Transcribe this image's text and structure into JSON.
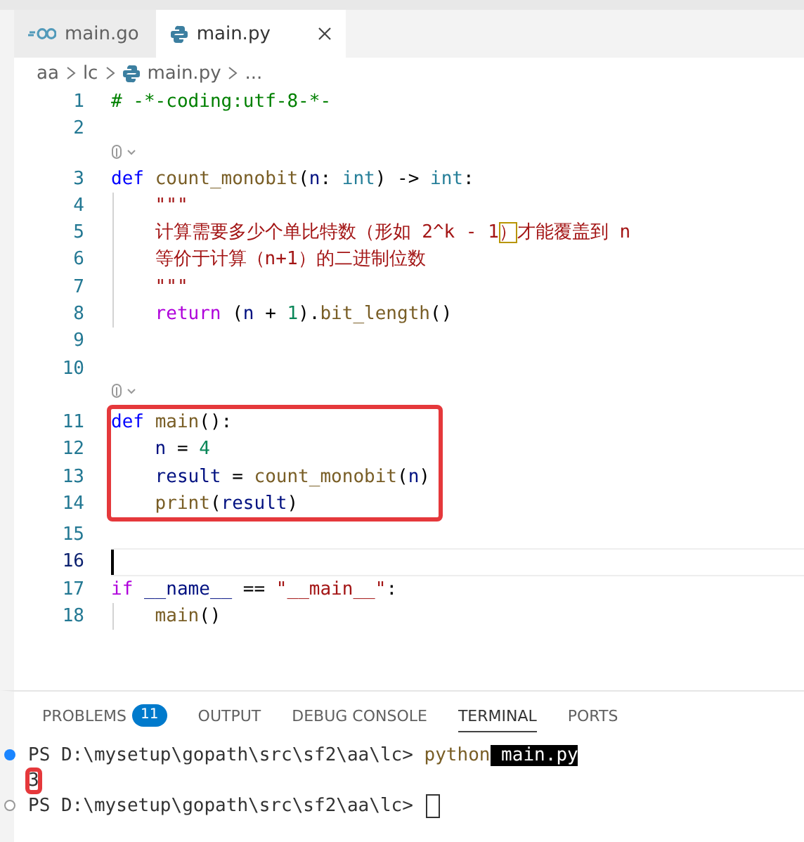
{
  "tabs": [
    {
      "label": "main.go",
      "kind": "go",
      "selected": false
    },
    {
      "label": "main.py",
      "kind": "python",
      "selected": true
    }
  ],
  "breadcrumb": [
    {
      "text": "aa",
      "kind": "folder"
    },
    {
      "text": "lc",
      "kind": "folder"
    },
    {
      "text": "main.py",
      "kind": "python"
    },
    {
      "text": "...",
      "kind": "more"
    }
  ],
  "editor": {
    "lines": [
      {
        "kind": "code",
        "number": "1",
        "tokens": [
          {
            "kind": "comment",
            "text": "# -*-coding:utf-8-*-"
          }
        ]
      },
      {
        "kind": "code",
        "number": "2"
      },
      {
        "kind": "codelens"
      },
      {
        "kind": "code",
        "number": "3",
        "tokens": [
          {
            "kind": "keyword",
            "text": "def "
          },
          {
            "kind": "function",
            "text": "count_monobit"
          },
          {
            "kind": "plain",
            "text": "("
          },
          {
            "kind": "variable",
            "text": "n"
          },
          {
            "kind": "plain",
            "text": ": "
          },
          {
            "kind": "type",
            "text": "int"
          },
          {
            "kind": "plain",
            "text": ") -> "
          },
          {
            "kind": "type",
            "text": "int"
          },
          {
            "kind": "plain",
            "text": ":"
          }
        ]
      },
      {
        "kind": "code",
        "number": "4",
        "guide": true,
        "tokens": [
          {
            "kind": "string",
            "text": "\"\"\""
          }
        ]
      },
      {
        "kind": "code",
        "number": "5",
        "guide": true,
        "tokens": [
          {
            "kind": "string",
            "text": "计算需要多少个单比特数（形如 2^k - 1"
          },
          {
            "kind": "bracket",
            "text": "）"
          },
          {
            "kind": "string",
            "text": "才能覆盖到 n"
          }
        ]
      },
      {
        "kind": "code",
        "number": "6",
        "guide": true,
        "tokens": [
          {
            "kind": "string",
            "text": "等价于计算（n+1）的二进制位数"
          }
        ]
      },
      {
        "kind": "code",
        "number": "7",
        "guide": true,
        "tokens": [
          {
            "kind": "string",
            "text": "\"\"\""
          }
        ]
      },
      {
        "kind": "code",
        "number": "8",
        "guide": true,
        "tokens": [
          {
            "kind": "control",
            "text": "return"
          },
          {
            "kind": "plain",
            "text": " ("
          },
          {
            "kind": "variable",
            "text": "n"
          },
          {
            "kind": "plain",
            "text": " + "
          },
          {
            "kind": "number",
            "text": "1"
          },
          {
            "kind": "plain",
            "text": ")."
          },
          {
            "kind": "function",
            "text": "bit_length"
          },
          {
            "kind": "plain",
            "text": "()"
          }
        ]
      },
      {
        "kind": "code",
        "number": "9"
      },
      {
        "kind": "code",
        "number": "10"
      },
      {
        "kind": "codelens"
      },
      {
        "kind": "boxed",
        "lines": [
          {
            "kind": "code",
            "number": "11",
            "tokens": [
              {
                "kind": "keyword",
                "text": "def "
              },
              {
                "kind": "function",
                "text": "main"
              },
              {
                "kind": "plain",
                "text": "():"
              }
            ]
          },
          {
            "kind": "code",
            "number": "12",
            "indented": true,
            "tokens": [
              {
                "kind": "variable",
                "text": "n"
              },
              {
                "kind": "plain",
                "text": " = "
              },
              {
                "kind": "number",
                "text": "4"
              }
            ]
          },
          {
            "kind": "code",
            "number": "13",
            "indented": true,
            "tokens": [
              {
                "kind": "variable",
                "text": "result"
              },
              {
                "kind": "plain",
                "text": " = "
              },
              {
                "kind": "function",
                "text": "count_monobit"
              },
              {
                "kind": "plain",
                "text": "("
              },
              {
                "kind": "variable",
                "text": "n"
              },
              {
                "kind": "plain",
                "text": ")"
              }
            ]
          },
          {
            "kind": "code",
            "number": "14",
            "indented": true,
            "tokens": [
              {
                "kind": "function",
                "text": "print"
              },
              {
                "kind": "plain",
                "text": "("
              },
              {
                "kind": "variable",
                "text": "result"
              },
              {
                "kind": "plain",
                "text": ")"
              }
            ]
          }
        ]
      },
      {
        "kind": "code",
        "number": "15"
      },
      {
        "kind": "code",
        "number": "16",
        "current": true
      },
      {
        "kind": "code",
        "number": "17",
        "tokens": [
          {
            "kind": "control",
            "text": "if "
          },
          {
            "kind": "variable",
            "text": "__name__"
          },
          {
            "kind": "plain",
            "text": " == "
          },
          {
            "kind": "string",
            "text": "\"__main__\""
          },
          {
            "kind": "plain",
            "text": ":"
          }
        ]
      },
      {
        "kind": "code",
        "number": "18",
        "guide": true,
        "tokens": [
          {
            "kind": "function",
            "text": "main"
          },
          {
            "kind": "plain",
            "text": "()"
          }
        ]
      }
    ]
  },
  "panel": {
    "tabs": [
      {
        "label": "PROBLEMS",
        "badge": "11",
        "selected": false
      },
      {
        "label": "OUTPUT",
        "selected": false
      },
      {
        "label": "DEBUG CONSOLE",
        "selected": false
      },
      {
        "label": "TERMINAL",
        "selected": true
      },
      {
        "label": "PORTS",
        "selected": false
      }
    ],
    "terminal": [
      {
        "dot": true,
        "dot_filled": true,
        "tokens": [
          {
            "kind": "plain",
            "text": "PS D:\\mysetup\\gopath\\src\\sf2\\aa\\lc> "
          },
          {
            "kind": "command",
            "text": "python"
          },
          {
            "kind": "selected",
            "text": " main.py"
          }
        ]
      },
      {
        "dot": false,
        "tokens": [
          {
            "kind": "boxed",
            "text": "3"
          }
        ]
      },
      {
        "dot": true,
        "dot_filled": false,
        "cursor": true,
        "tokens": [
          {
            "kind": "plain",
            "text": "PS D:\\mysetup\\gopath\\src\\sf2\\aa\\lc> "
          }
        ]
      }
    ]
  }
}
